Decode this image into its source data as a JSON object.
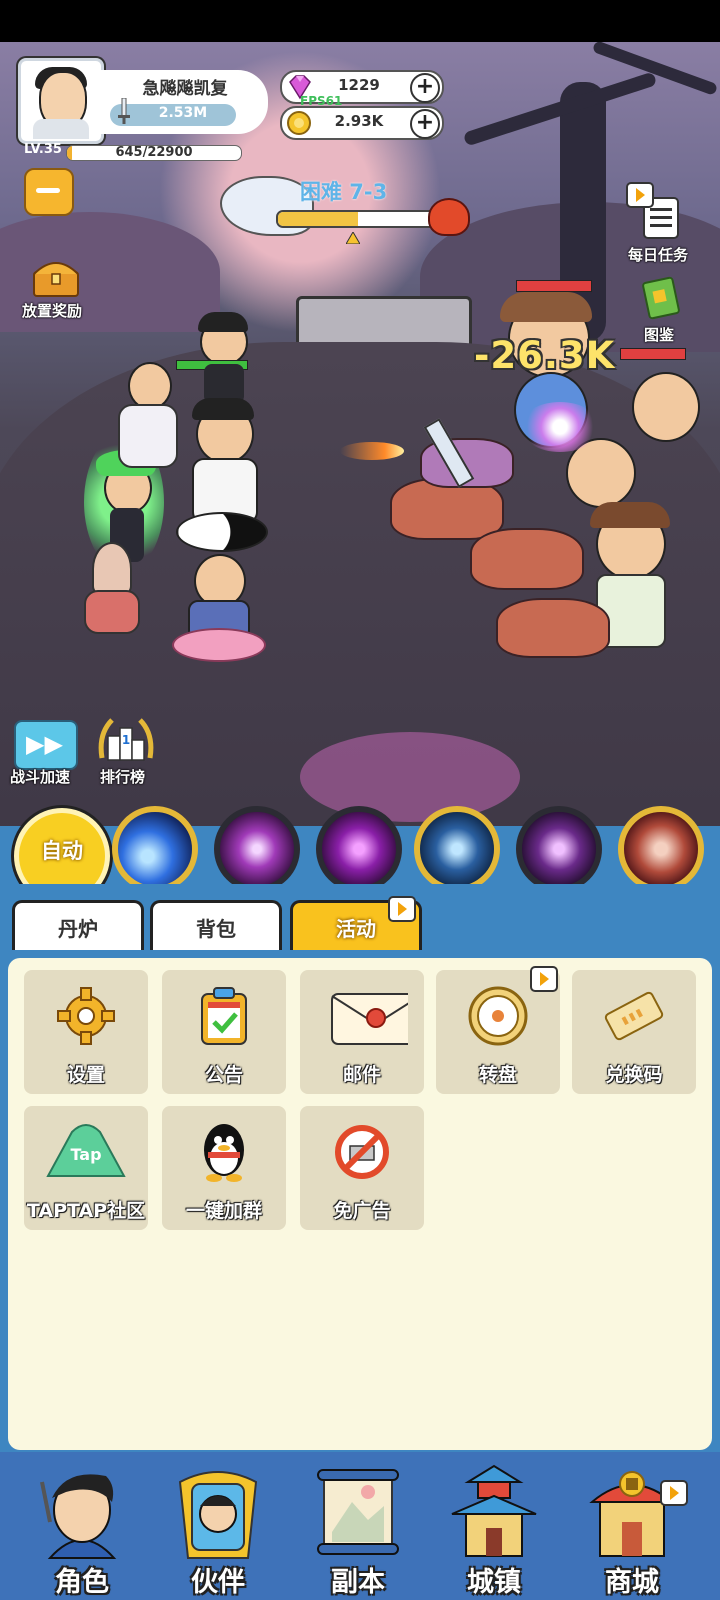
{
  "player": {
    "name": "急飚飚凯复",
    "power": "2.53M",
    "level": "LV.35",
    "exp_text": "645/22900",
    "exp_fraction": 0.028
  },
  "currency": {
    "gems": "1229",
    "coins": "2.93K",
    "fps_label": "FPS61"
  },
  "stage": {
    "label": "困难 7-3",
    "progress_fraction": 0.5
  },
  "battle": {
    "damage_text": "-26.3K"
  },
  "left_menu": {
    "idle_reward_label": "放置奖励",
    "speed_label": "战斗加速",
    "ranking_label": "排行榜"
  },
  "right_menu": {
    "daily_tasks_label": "每日任务",
    "codex_label": "图鉴"
  },
  "skills": {
    "auto_label": "自动",
    "icons": [
      "blue-comet-skill-icon",
      "purple-lightning-skill-icon",
      "purple-vortex-skill-icon",
      "ice-rune-skill-icon",
      "dark-shuriken-skill-icon",
      "beast-roar-skill-icon"
    ]
  },
  "tabs": [
    {
      "label": "丹炉",
      "active": false
    },
    {
      "label": "背包",
      "active": false
    },
    {
      "label": "活动",
      "active": true
    }
  ],
  "activities": [
    {
      "label": "设置",
      "icon": "gear-icon"
    },
    {
      "label": "公告",
      "icon": "clipboard-check-icon"
    },
    {
      "label": "邮件",
      "icon": "envelope-icon"
    },
    {
      "label": "转盘",
      "icon": "wheel-icon"
    },
    {
      "label": "兑换码",
      "icon": "ticket-icon"
    },
    {
      "label": "TAPTAP社区",
      "icon": "taptap-icon"
    },
    {
      "label": "一键加群",
      "icon": "penguin-icon"
    },
    {
      "label": "免广告",
      "icon": "no-ads-icon"
    }
  ],
  "bottom_nav": [
    {
      "label": "角色",
      "icon": "character-icon"
    },
    {
      "label": "伙伴",
      "icon": "partner-icon"
    },
    {
      "label": "副本",
      "icon": "scroll-icon"
    },
    {
      "label": "城镇",
      "icon": "pagoda-icon"
    },
    {
      "label": "商城",
      "icon": "shop-icon"
    }
  ],
  "colors": {
    "frame_blue": "#3e86c1",
    "panel_cream": "#faf8e0",
    "tile": "#e3dcc2",
    "active_tab": "#f9c21e",
    "auto_button": "#f8cf22"
  }
}
